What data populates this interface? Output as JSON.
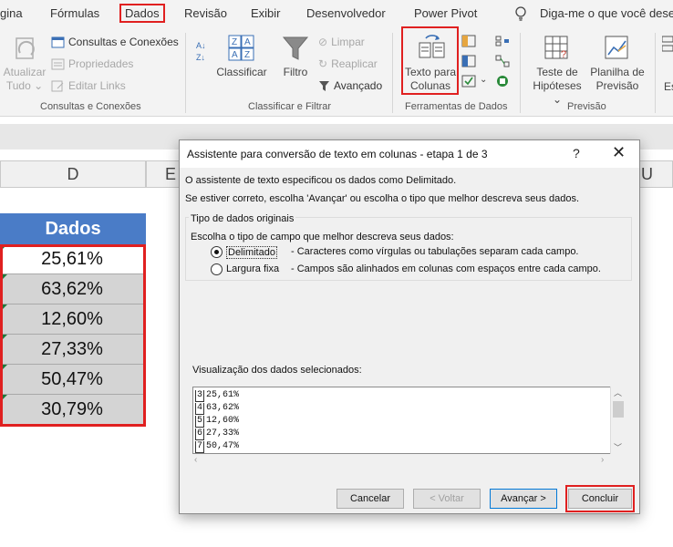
{
  "ribbon_tabs": {
    "t0": "gina",
    "t1": "Fórmulas",
    "t2": "Dados",
    "t3": "Revisão",
    "t4": "Exibir",
    "t5": "Desenvolvedor",
    "t6": "Power Pivot",
    "tellme": "Diga-me o que você dese"
  },
  "ribbon": {
    "atualizar_tudo": [
      "Atualizar",
      "Tudo ⌄"
    ],
    "consultas_conexoes": "Consultas e Conexões",
    "propriedades": "Propriedades",
    "editar_links": "Editar Links",
    "grp_consultas": "Consultas e Conexões",
    "classificar": "Classificar",
    "filtro": "Filtro",
    "limpar": "Limpar",
    "reaplicar": "Reaplicar",
    "avancado": "Avançado",
    "grp_classificar": "Classificar e Filtrar",
    "texto_para": [
      "Texto para",
      "Colunas"
    ],
    "grp_ferramentas": "Ferramentas de Dados",
    "teste_hipoteses": [
      "Teste de",
      "Hipóteses ⌄"
    ],
    "planilha_previsao": [
      "Planilha de",
      "Previsão"
    ],
    "grp_previsao": "Previsão",
    "cut_label": "Es"
  },
  "sheet": {
    "col_d": "D",
    "col_e": "E",
    "col_u": "U",
    "header": "Dados",
    "values": [
      "25,61%",
      "63,62%",
      "12,60%",
      "27,33%",
      "50,47%",
      "30,79%"
    ]
  },
  "dialog": {
    "title": "Assistente para conversão de texto em colunas - etapa 1 de 3",
    "help": "?",
    "close": "✕",
    "line1": "O assistente de texto especificou os dados como Delimitado.",
    "line2": "Se estiver correto, escolha 'Avançar' ou escolha o tipo que melhor descreva seus dados.",
    "group_label": "Tipo de dados originais",
    "prompt": "Escolha o tipo de campo que melhor descreva seus dados:",
    "opt_delimitado": "Delimitado",
    "opt_delimitado_desc": "- Caracteres como vírgulas ou tabulações separam cada campo.",
    "opt_largura": "Largura fixa",
    "opt_largura_desc": "- Campos são alinhados em colunas com espaços entre cada campo.",
    "selected_option": "Delimitado",
    "preview_label": "Visualização dos dados selecionados:",
    "preview_rows": [
      {
        "n": "3",
        "v": "25,61%"
      },
      {
        "n": "4",
        "v": "63,62%"
      },
      {
        "n": "5",
        "v": "12,60%"
      },
      {
        "n": "6",
        "v": "27,33%"
      },
      {
        "n": "7",
        "v": "50,47%"
      }
    ],
    "btn_cancelar": "Cancelar",
    "btn_voltar": "< Voltar",
    "btn_avancar": "Avançar >",
    "btn_concluir": "Concluir"
  },
  "colors": {
    "highlight": "#e02020",
    "header_blue": "#4a7cc7",
    "cell_gray": "#d4d4d4",
    "error_triangle": "#1e7a3c"
  }
}
